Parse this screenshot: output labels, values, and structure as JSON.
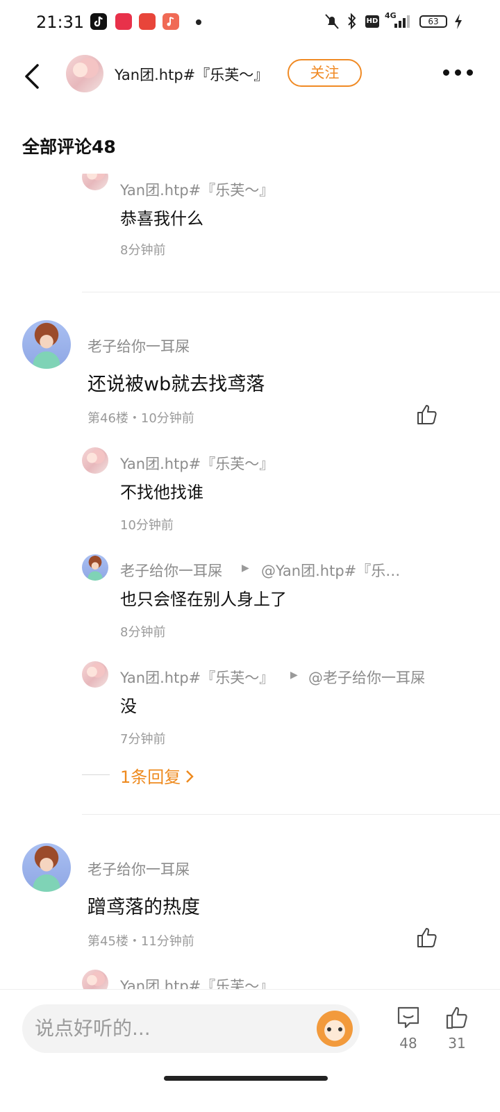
{
  "status_bar": {
    "time": "21:31",
    "app_icons": [
      "tiktok-icon",
      "app-icon-red",
      "toutiao-icon",
      "music-icon"
    ],
    "battery": "63",
    "network": "4G"
  },
  "header": {
    "username": "Yan团.htp#『乐芙～』",
    "follow_label": "关注"
  },
  "section_title": "全部评论48",
  "comments": [
    {
      "author": "Yan团.htp#『乐芙～』",
      "text": "恭喜我什么",
      "time": "8分钟前"
    },
    {
      "author": "老子给你一耳屎",
      "text": "还说被wb就去找鸢落",
      "meta": "第46楼・10分钟前",
      "replies": [
        {
          "author": "Yan团.htp#『乐芙～』",
          "text": "不找他找谁",
          "time": "10分钟前"
        },
        {
          "author": "老子给你一耳屎",
          "reply_to": "@Yan团.htp#『乐…",
          "text": "也只会怪在别人身上了",
          "time": "8分钟前"
        },
        {
          "author": "Yan团.htp#『乐芙～』",
          "reply_to": "@老子给你一耳屎",
          "text": "没",
          "time": "7分钟前"
        }
      ],
      "more_replies": "1条回复"
    },
    {
      "author": "老子给你一耳屎",
      "text": "蹭鸢落的热度",
      "meta": "第45楼・11分钟前",
      "replies": [
        {
          "author": "Yan团.htp#『乐芙～』"
        }
      ]
    }
  ],
  "bottom_bar": {
    "input_placeholder": "说点好听的...",
    "comment_count": "48",
    "like_count": "31"
  },
  "colors": {
    "accent": "#f08a24",
    "muted_text": "#9a9a9a"
  }
}
